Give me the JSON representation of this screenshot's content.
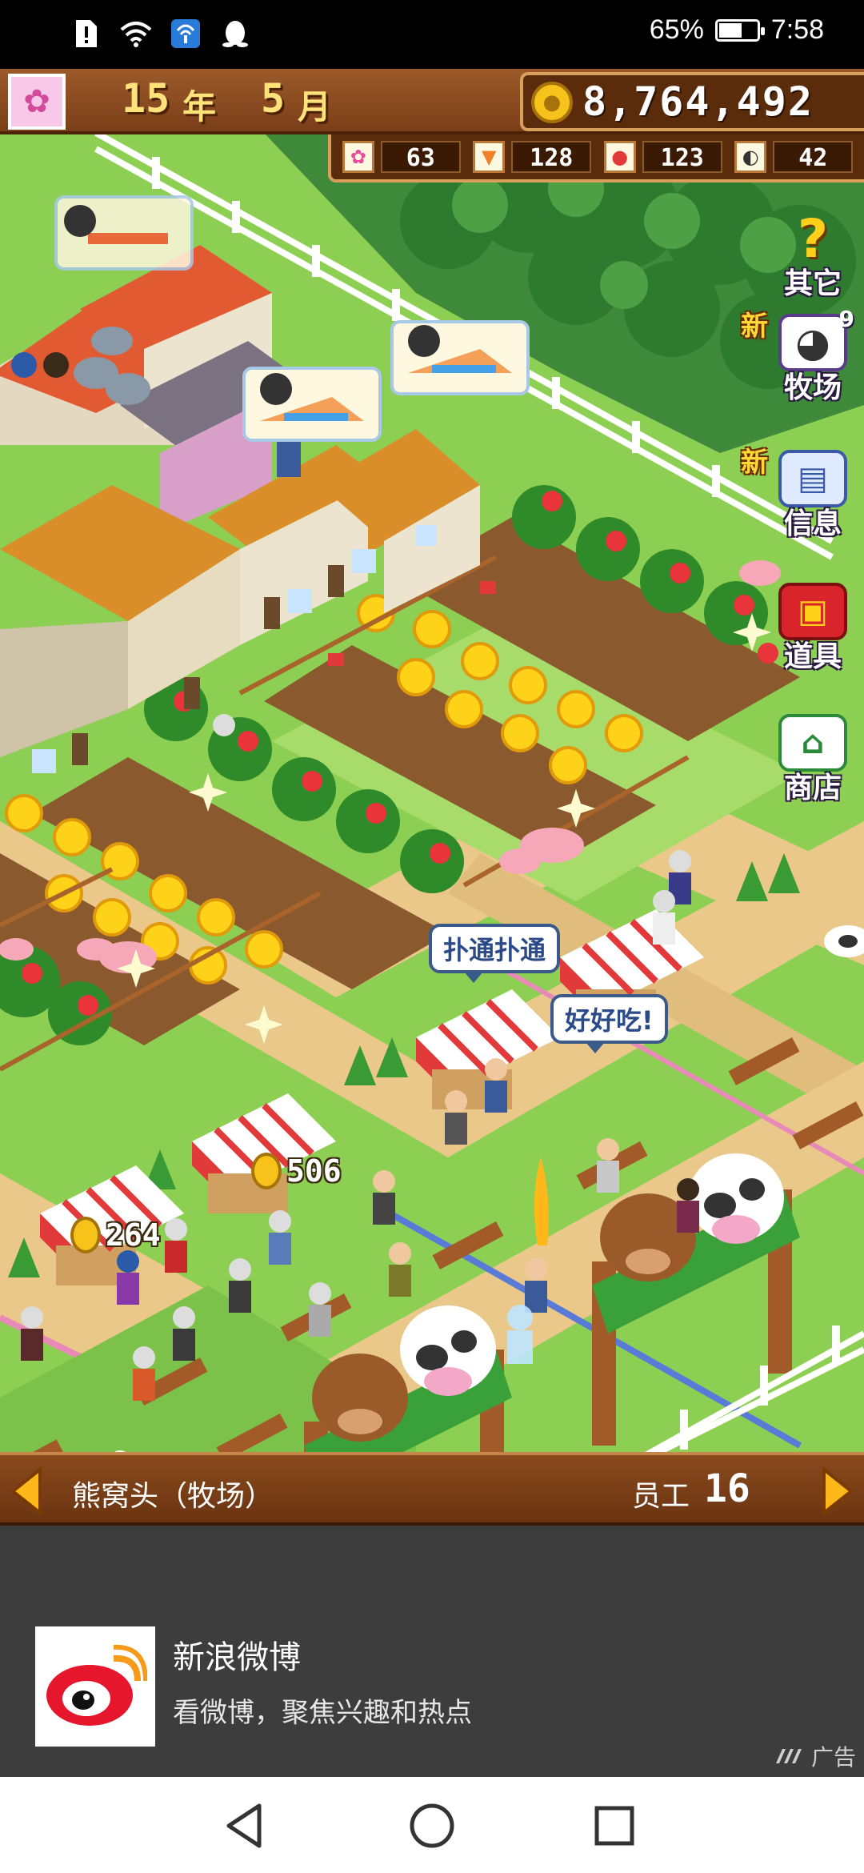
{
  "status_bar": {
    "battery_percent": "65%",
    "battery_level": 0.65,
    "time": "7:58"
  },
  "hud": {
    "year": "15",
    "year_unit": "年",
    "month": "5",
    "month_unit": "月",
    "money": "8,764,492",
    "resources": [
      {
        "icon": "flower-icon",
        "value": "63"
      },
      {
        "icon": "carrot-icon",
        "value": "128"
      },
      {
        "icon": "strawberry-icon",
        "value": "123"
      },
      {
        "icon": "cow-icon",
        "value": "42"
      }
    ]
  },
  "side_menu": {
    "other_label": "其它",
    "ranch_label": "牧场",
    "ranch_new": "新",
    "ranch_count": "9",
    "info_label": "信息",
    "info_new": "新",
    "items_label": "道具",
    "shop_label": "商店"
  },
  "bubbles": {
    "heartbeat": "扑通扑通",
    "delicious": "好好吃!"
  },
  "coin_pops": {
    "left": "264",
    "center": "506"
  },
  "farm_bar": {
    "name": "熊窝头（牧场）",
    "staff_label": "员工",
    "staff_count": "16"
  },
  "ad": {
    "title": "新浪微博",
    "subtitle": "看微博，聚焦兴趣和热点",
    "tag": "广告"
  },
  "colors": {
    "grass": "#8ccf52",
    "path": "#e9c88a",
    "hud_brown": "#7a3e18",
    "ad_bg": "#3d3d3d",
    "weibo_red": "#e6162d"
  }
}
